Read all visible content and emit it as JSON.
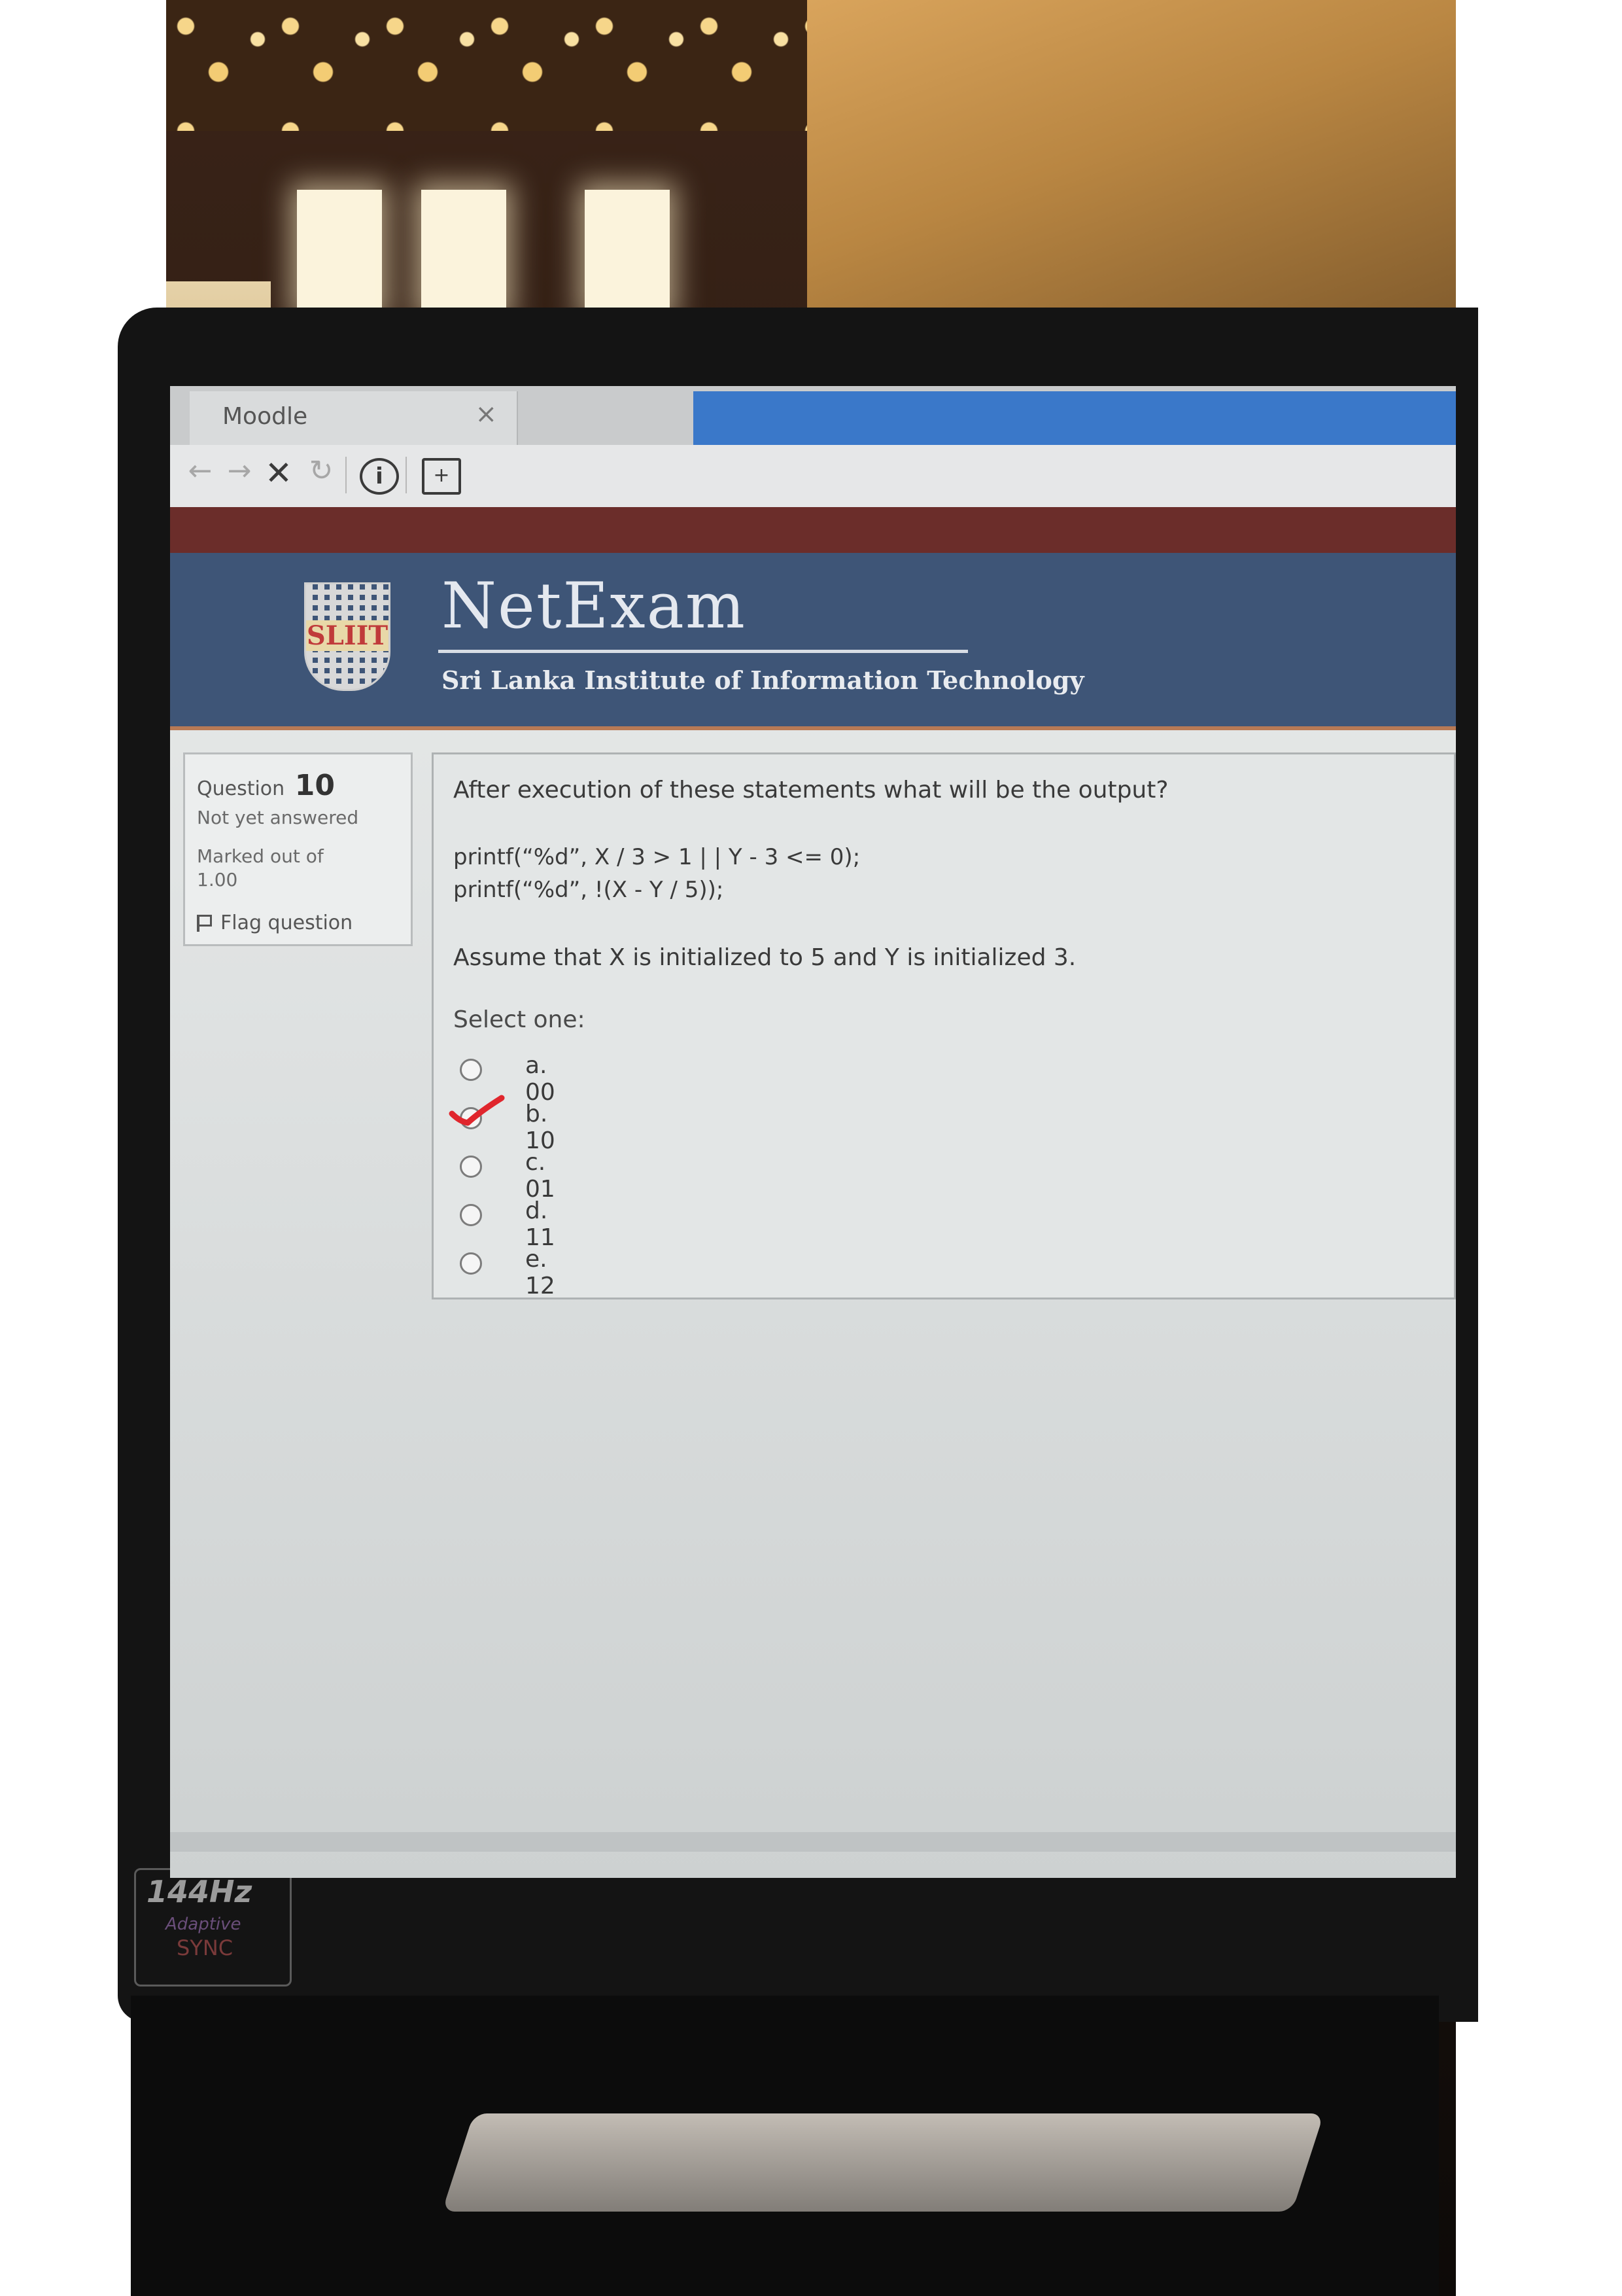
{
  "browser": {
    "tab_title": "Moodle",
    "tab_close": "×",
    "nav": {
      "back": "←",
      "forward": "→",
      "stop": "✕",
      "reload": "↻",
      "info": "i",
      "page": "+"
    }
  },
  "site": {
    "logo_text": "SLIIT",
    "title": "NetExam",
    "subtitle": "Sri Lanka Institute of Information Technology"
  },
  "question_info": {
    "label": "Question",
    "number": "10",
    "state": "Not yet answered",
    "marks_line1": "Marked out of",
    "marks_line2": "1.00",
    "flag_label": "Flag question"
  },
  "question": {
    "text": "After execution of these statements what will be the output?",
    "code_line1": "printf(“%d”, X / 3 > 1 | | Y - 3 <= 0);",
    "code_line2": "printf(“%d”, !(X - Y / 5));",
    "assumption": "Assume that X is initialized to 5 and Y is initialized 3.",
    "select_prompt": "Select one:",
    "options": [
      {
        "label": "a. 00"
      },
      {
        "label": "b. 10",
        "handwritten_tick": true
      },
      {
        "label": "c. 01"
      },
      {
        "label": "d. 11"
      },
      {
        "label": "e. 12"
      }
    ]
  },
  "laptop_badge": {
    "line1": "144Hz",
    "line2": "Adaptive",
    "line3": "SYNC"
  },
  "colors": {
    "header": "#3e5577",
    "maroon_bar": "#6b2d2a",
    "tab_accent": "#3a78c9",
    "tick": "#e0262d"
  }
}
